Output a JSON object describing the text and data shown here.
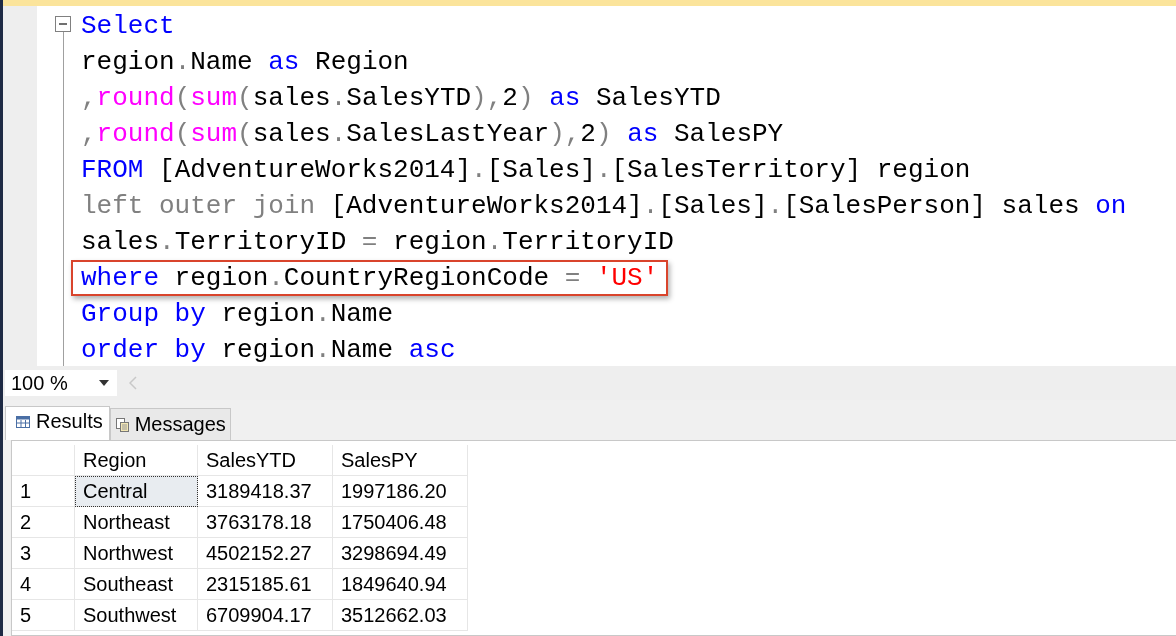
{
  "editor": {
    "lines": [
      {
        "highlighted": false,
        "tokens": [
          {
            "t": "Select",
            "kind": "keyword"
          }
        ]
      },
      {
        "highlighted": false,
        "tokens": [
          {
            "t": "region",
            "kind": "plain"
          },
          {
            "t": ".",
            "kind": "operator"
          },
          {
            "t": "Name ",
            "kind": "plain"
          },
          {
            "t": "as",
            "kind": "keyword"
          },
          {
            "t": " Region",
            "kind": "plain"
          }
        ]
      },
      {
        "highlighted": false,
        "tokens": [
          {
            "t": ",",
            "kind": "operator"
          },
          {
            "t": "round",
            "kind": "function"
          },
          {
            "t": "(",
            "kind": "operator"
          },
          {
            "t": "sum",
            "kind": "function"
          },
          {
            "t": "(",
            "kind": "operator"
          },
          {
            "t": "sales",
            "kind": "plain"
          },
          {
            "t": ".",
            "kind": "operator"
          },
          {
            "t": "SalesYTD",
            "kind": "plain"
          },
          {
            "t": "),",
            "kind": "operator"
          },
          {
            "t": "2",
            "kind": "plain"
          },
          {
            "t": ")",
            "kind": "operator"
          },
          {
            "t": " as",
            "kind": "keyword"
          },
          {
            "t": " SalesYTD",
            "kind": "plain"
          }
        ]
      },
      {
        "highlighted": false,
        "tokens": [
          {
            "t": ",",
            "kind": "operator"
          },
          {
            "t": "round",
            "kind": "function"
          },
          {
            "t": "(",
            "kind": "operator"
          },
          {
            "t": "sum",
            "kind": "function"
          },
          {
            "t": "(",
            "kind": "operator"
          },
          {
            "t": "sales",
            "kind": "plain"
          },
          {
            "t": ".",
            "kind": "operator"
          },
          {
            "t": "SalesLastYear",
            "kind": "plain"
          },
          {
            "t": "),",
            "kind": "operator"
          },
          {
            "t": "2",
            "kind": "plain"
          },
          {
            "t": ")",
            "kind": "operator"
          },
          {
            "t": " as",
            "kind": "keyword"
          },
          {
            "t": " SalesPY",
            "kind": "plain"
          }
        ]
      },
      {
        "highlighted": false,
        "tokens": [
          {
            "t": "FROM",
            "kind": "keyword"
          },
          {
            "t": " [AdventureWorks2014]",
            "kind": "plain"
          },
          {
            "t": ".",
            "kind": "operator"
          },
          {
            "t": "[Sales]",
            "kind": "plain"
          },
          {
            "t": ".",
            "kind": "operator"
          },
          {
            "t": "[SalesTerritory] region",
            "kind": "plain"
          }
        ]
      },
      {
        "highlighted": false,
        "tokens": [
          {
            "t": "left outer join",
            "kind": "operator"
          },
          {
            "t": " [AdventureWorks2014]",
            "kind": "plain"
          },
          {
            "t": ".",
            "kind": "operator"
          },
          {
            "t": "[Sales]",
            "kind": "plain"
          },
          {
            "t": ".",
            "kind": "operator"
          },
          {
            "t": "[SalesPerson] sales ",
            "kind": "plain"
          },
          {
            "t": "on",
            "kind": "keyword"
          }
        ]
      },
      {
        "highlighted": false,
        "tokens": [
          {
            "t": "sales",
            "kind": "plain"
          },
          {
            "t": ".",
            "kind": "operator"
          },
          {
            "t": "TerritoryID ",
            "kind": "plain"
          },
          {
            "t": "=",
            "kind": "operator"
          },
          {
            "t": " region",
            "kind": "plain"
          },
          {
            "t": ".",
            "kind": "operator"
          },
          {
            "t": "TerritoryID",
            "kind": "plain"
          }
        ]
      },
      {
        "highlighted": true,
        "tokens": [
          {
            "t": "where",
            "kind": "keyword"
          },
          {
            "t": " region",
            "kind": "plain"
          },
          {
            "t": ".",
            "kind": "operator"
          },
          {
            "t": "CountryRegionCode ",
            "kind": "plain"
          },
          {
            "t": "=",
            "kind": "operator"
          },
          {
            "t": " 'US'",
            "kind": "string"
          }
        ]
      },
      {
        "highlighted": false,
        "tokens": [
          {
            "t": "Group by",
            "kind": "keyword"
          },
          {
            "t": " region",
            "kind": "plain"
          },
          {
            "t": ".",
            "kind": "operator"
          },
          {
            "t": "Name",
            "kind": "plain"
          }
        ]
      },
      {
        "highlighted": false,
        "tokens": [
          {
            "t": "order by",
            "kind": "keyword"
          },
          {
            "t": " region",
            "kind": "plain"
          },
          {
            "t": ".",
            "kind": "operator"
          },
          {
            "t": "Name ",
            "kind": "plain"
          },
          {
            "t": "asc",
            "kind": "keyword"
          }
        ]
      }
    ]
  },
  "zoom": {
    "value": "100 %"
  },
  "tabs": [
    {
      "label": "Results",
      "selected": true
    },
    {
      "label": "Messages",
      "selected": false
    }
  ],
  "grid": {
    "columns": [
      "Region",
      "SalesYTD",
      "SalesPY"
    ],
    "rows": [
      {
        "num": "1",
        "cells": [
          {
            "text": "Central",
            "selected": true
          },
          {
            "text": "3189418.37",
            "selected": false
          },
          {
            "text": "1997186.20",
            "selected": false
          }
        ]
      },
      {
        "num": "2",
        "cells": [
          {
            "text": "Northeast",
            "selected": false
          },
          {
            "text": "3763178.18",
            "selected": false
          },
          {
            "text": "1750406.48",
            "selected": false
          }
        ]
      },
      {
        "num": "3",
        "cells": [
          {
            "text": "Northwest",
            "selected": false
          },
          {
            "text": "4502152.27",
            "selected": false
          },
          {
            "text": "3298694.49",
            "selected": false
          }
        ]
      },
      {
        "num": "4",
        "cells": [
          {
            "text": "Southeast",
            "selected": false
          },
          {
            "text": "2315185.61",
            "selected": false
          },
          {
            "text": "1849640.94",
            "selected": false
          }
        ]
      },
      {
        "num": "5",
        "cells": [
          {
            "text": "Southwest",
            "selected": false
          },
          {
            "text": "6709904.17",
            "selected": false
          },
          {
            "text": "3512662.03",
            "selected": false
          }
        ]
      }
    ]
  }
}
